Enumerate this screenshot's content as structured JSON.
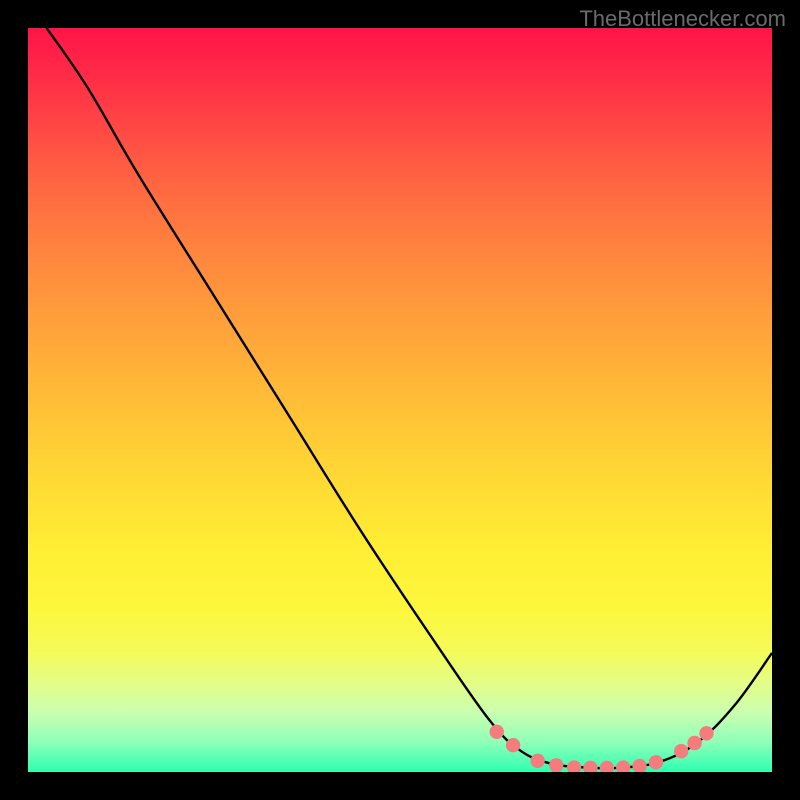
{
  "attribution": "TheBottlenecker.com",
  "chart_data": {
    "type": "line",
    "title": "",
    "xlabel": "",
    "ylabel": "",
    "xlim": [
      0,
      100
    ],
    "ylim": [
      0,
      100
    ],
    "series": [
      {
        "name": "curve",
        "points": [
          {
            "x": 2.5,
            "y": 100
          },
          {
            "x": 8,
            "y": 92
          },
          {
            "x": 15,
            "y": 80
          },
          {
            "x": 25,
            "y": 64
          },
          {
            "x": 35,
            "y": 48
          },
          {
            "x": 45,
            "y": 32
          },
          {
            "x": 55,
            "y": 17
          },
          {
            "x": 62,
            "y": 7
          },
          {
            "x": 66,
            "y": 3
          },
          {
            "x": 70,
            "y": 1.2
          },
          {
            "x": 75,
            "y": 0.6
          },
          {
            "x": 80,
            "y": 0.6
          },
          {
            "x": 85,
            "y": 1.4
          },
          {
            "x": 90,
            "y": 4
          },
          {
            "x": 95,
            "y": 9
          },
          {
            "x": 100,
            "y": 16
          }
        ]
      }
    ],
    "markers": [
      {
        "x": 63,
        "y": 5.4
      },
      {
        "x": 65.2,
        "y": 3.6
      },
      {
        "x": 68.5,
        "y": 1.5
      },
      {
        "x": 71,
        "y": 0.9
      },
      {
        "x": 73.4,
        "y": 0.6
      },
      {
        "x": 75.6,
        "y": 0.55
      },
      {
        "x": 77.8,
        "y": 0.55
      },
      {
        "x": 80,
        "y": 0.6
      },
      {
        "x": 82.2,
        "y": 0.8
      },
      {
        "x": 84.4,
        "y": 1.3
      },
      {
        "x": 87.8,
        "y": 2.8
      },
      {
        "x": 89.6,
        "y": 3.9
      },
      {
        "x": 91.2,
        "y": 5.2
      }
    ],
    "background": {
      "type": "vertical-gradient",
      "stops": [
        {
          "pos": 0,
          "color": "#ff1448"
        },
        {
          "pos": 50,
          "color": "#ffcc36"
        },
        {
          "pos": 78,
          "color": "#fdf73c"
        },
        {
          "pos": 100,
          "color": "#2dffb0"
        }
      ]
    }
  }
}
